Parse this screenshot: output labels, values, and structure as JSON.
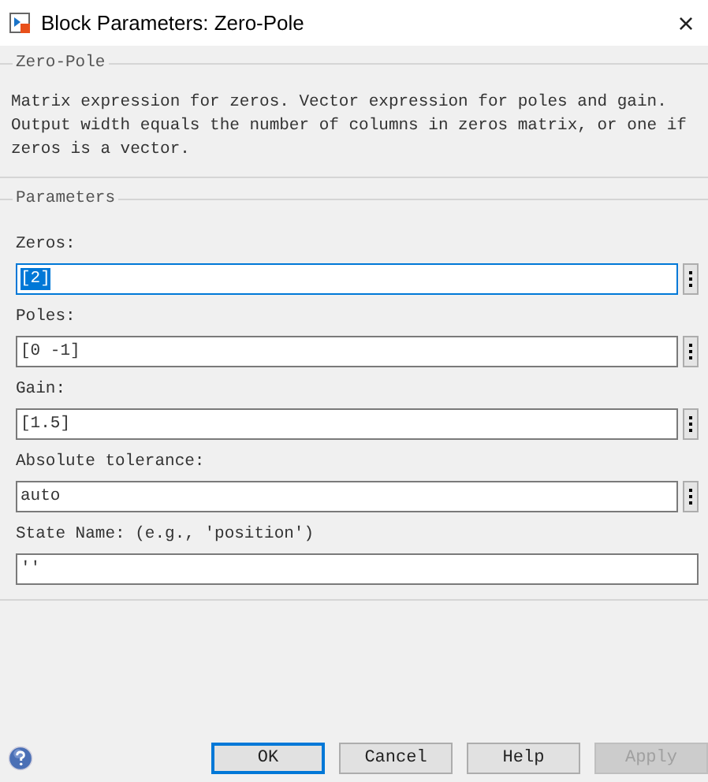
{
  "window": {
    "title": "Block Parameters: Zero-Pole",
    "close": "×"
  },
  "block": {
    "title": "Zero-Pole",
    "description": "Matrix expression for zeros.  Vector expression for poles and gain. Output width equals the number of columns in zeros matrix, or one if zeros is a vector."
  },
  "parameters": {
    "title": "Parameters",
    "fields": [
      {
        "label": "Zeros:",
        "value": "[2]",
        "kind": "expression",
        "focused": true
      },
      {
        "label": "Poles:",
        "value": "[0 -1]",
        "kind": "expression",
        "focused": false
      },
      {
        "label": "Gain:",
        "value": "[1.5]",
        "kind": "expression",
        "focused": false
      },
      {
        "label": "Absolute tolerance:",
        "value": "auto",
        "kind": "expression",
        "focused": false
      },
      {
        "label": "State Name: (e.g., 'position')",
        "value": "''",
        "kind": "text",
        "focused": false
      }
    ]
  },
  "buttons": [
    {
      "label": "OK",
      "default": true,
      "disabled": false
    },
    {
      "label": "Cancel",
      "default": false,
      "disabled": false
    },
    {
      "label": "Help",
      "default": false,
      "disabled": false
    },
    {
      "label": "Apply",
      "default": false,
      "disabled": true
    }
  ]
}
